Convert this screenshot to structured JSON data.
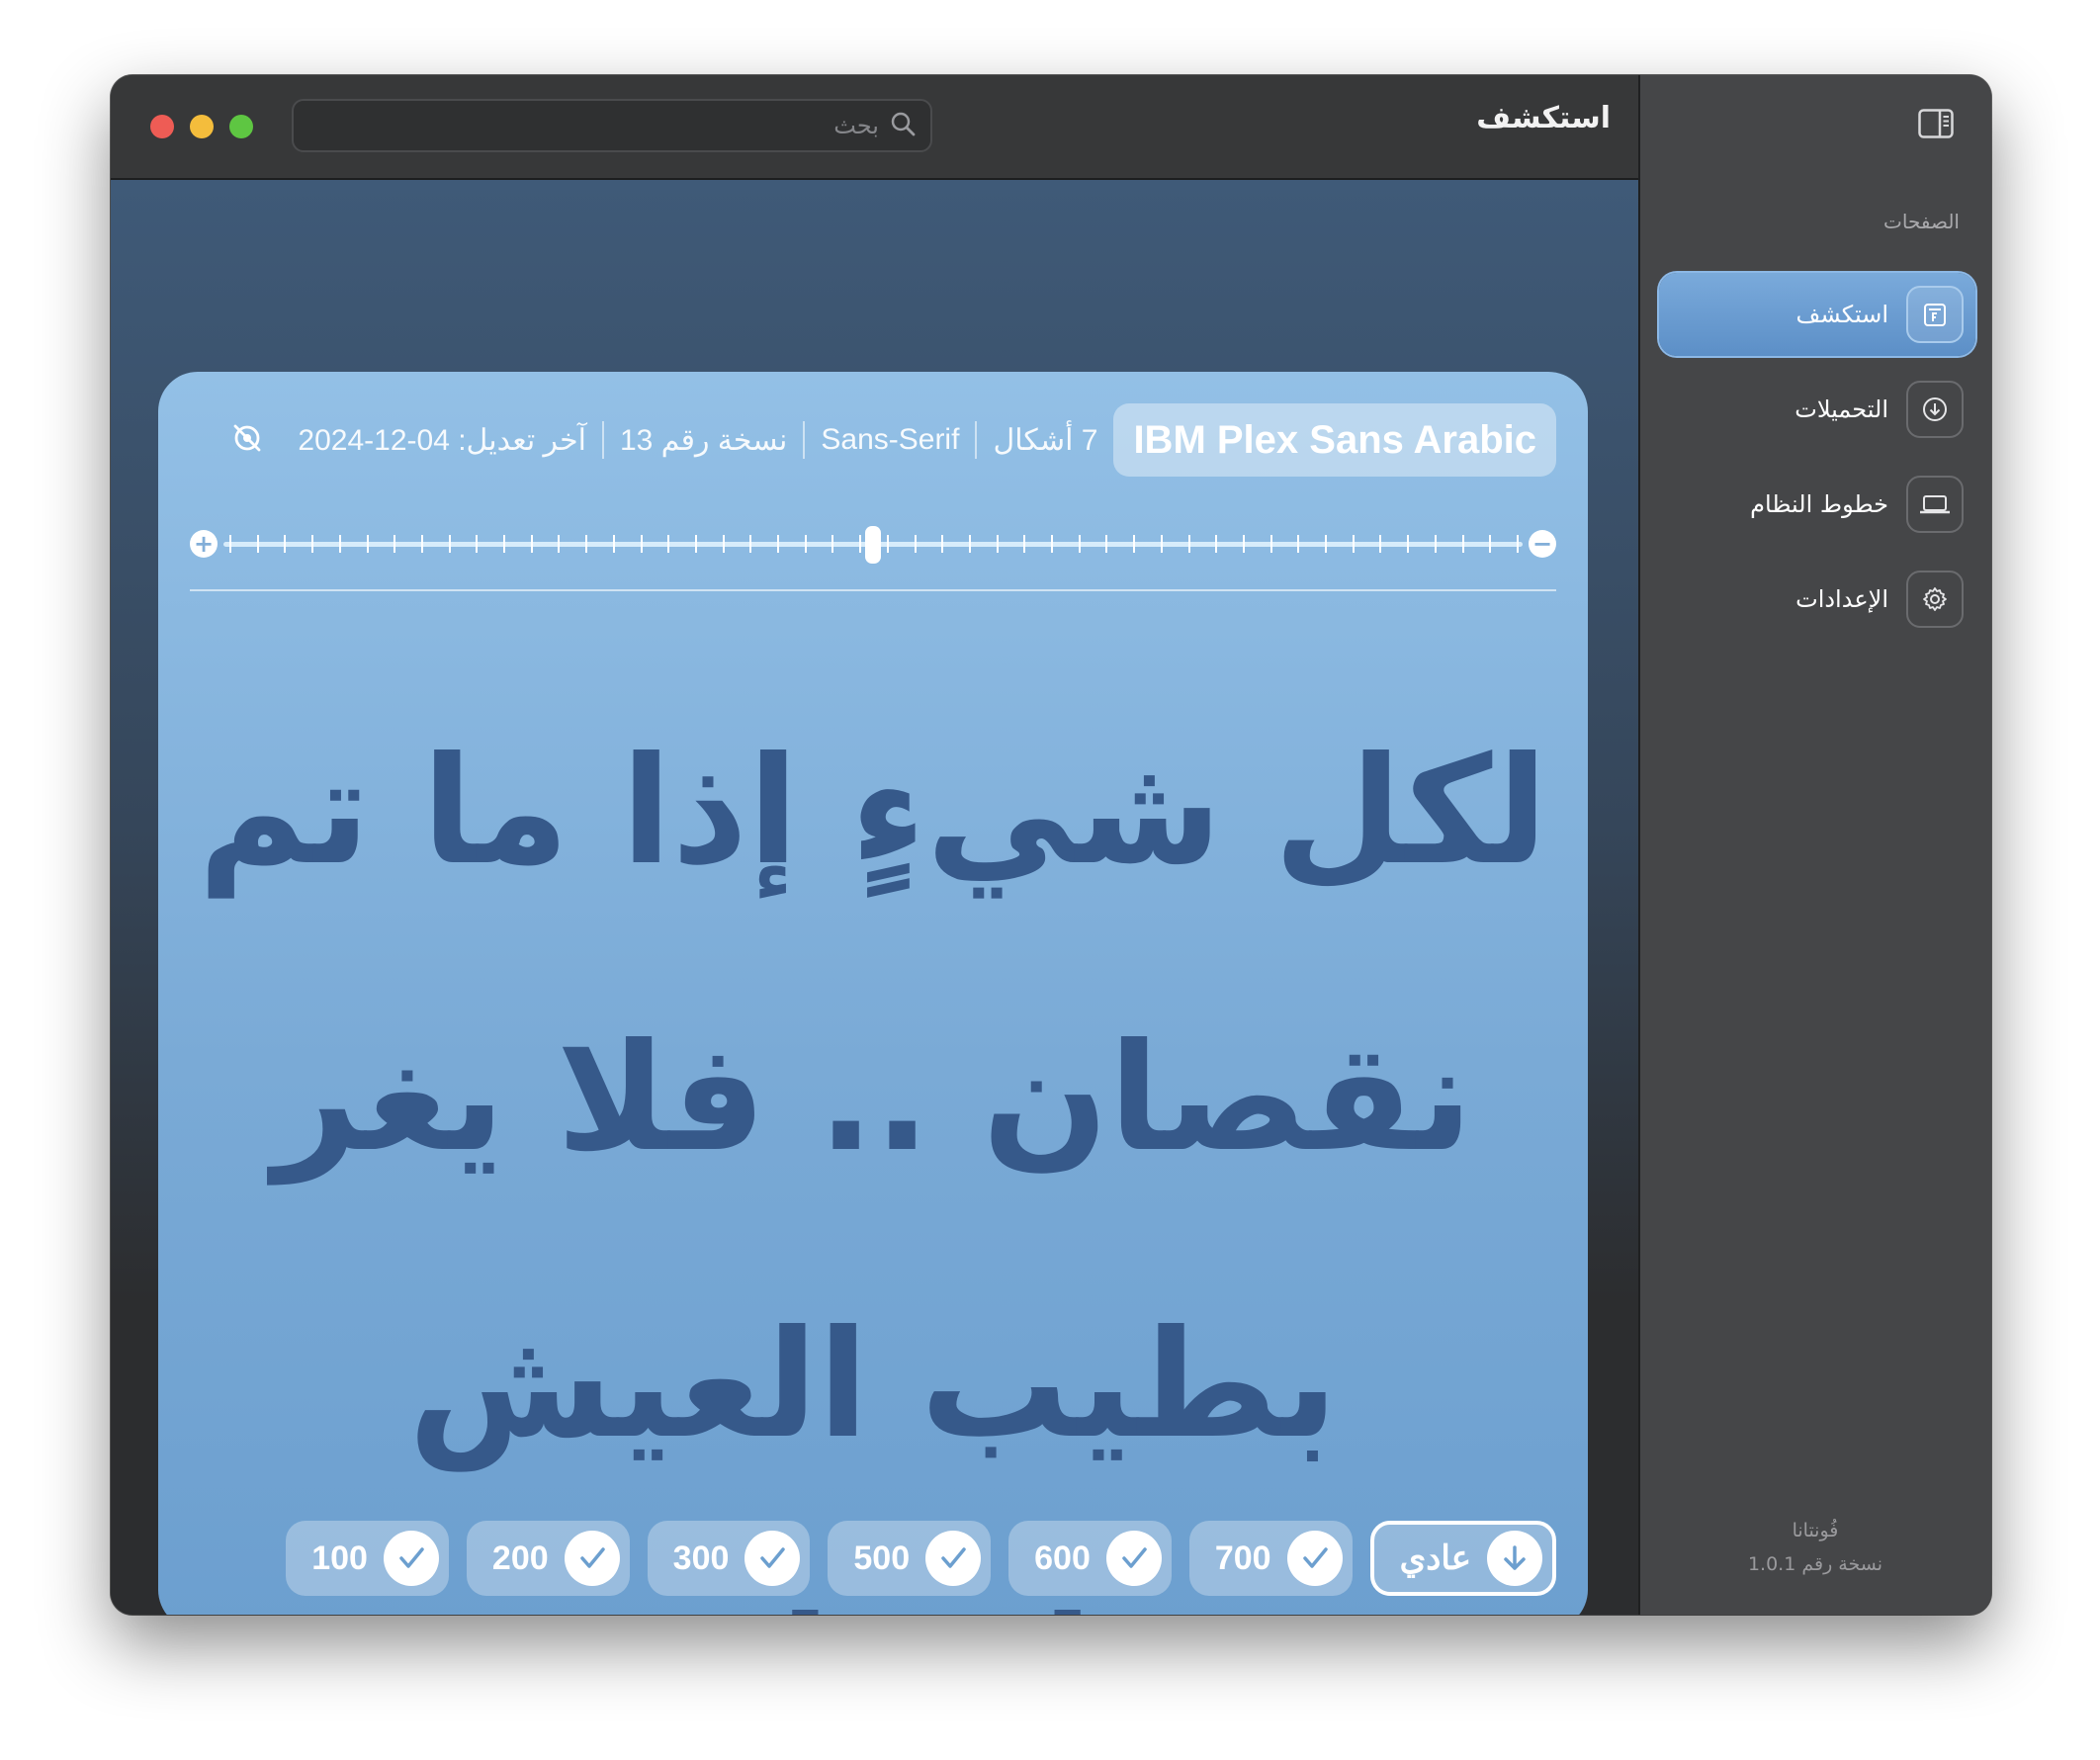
{
  "app": {
    "title": "استكشف",
    "search_placeholder": "بحث"
  },
  "sidebar": {
    "section_label": "الصفحات",
    "items": [
      {
        "label": "استكشف",
        "icon": "explore-icon",
        "active": true
      },
      {
        "label": "التحميلات",
        "icon": "download-circle-icon",
        "active": false
      },
      {
        "label": "خطوط النظام",
        "icon": "laptop-icon",
        "active": false
      },
      {
        "label": "الإعدادات",
        "icon": "gear-icon",
        "active": false
      }
    ],
    "app_name": "فُونتانا",
    "app_version": "نسخة رقم 1.0.1"
  },
  "font_card": {
    "font_name": "IBM Plex Sans Arabic",
    "styles_count": "7 أشكال",
    "category": "Sans-Serif",
    "version": "نسخة رقم 13",
    "last_modified": "آخر تعديل: 04-12-2024",
    "sample_text": "لكل شيءٍ إذا ما تم نقصان .. فلا يغر بطيب العيش إنسان",
    "size_slider": {
      "value_fraction": 0.5
    },
    "weights": [
      {
        "label": "عادي",
        "state": "download",
        "selected": true
      },
      {
        "label": "700",
        "state": "installed",
        "selected": false
      },
      {
        "label": "600",
        "state": "installed",
        "selected": false
      },
      {
        "label": "500",
        "state": "installed",
        "selected": false
      },
      {
        "label": "300",
        "state": "installed",
        "selected": false
      },
      {
        "label": "200",
        "state": "installed",
        "selected": false
      },
      {
        "label": "100",
        "state": "installed",
        "selected": false
      }
    ]
  },
  "colors": {
    "accent": "#5c8fc7",
    "card_top": "#93c0e6",
    "sample_text": "#36598a",
    "traffic_close": "#ee5c55",
    "traffic_min": "#f4bd3c",
    "traffic_max": "#5ec642"
  }
}
